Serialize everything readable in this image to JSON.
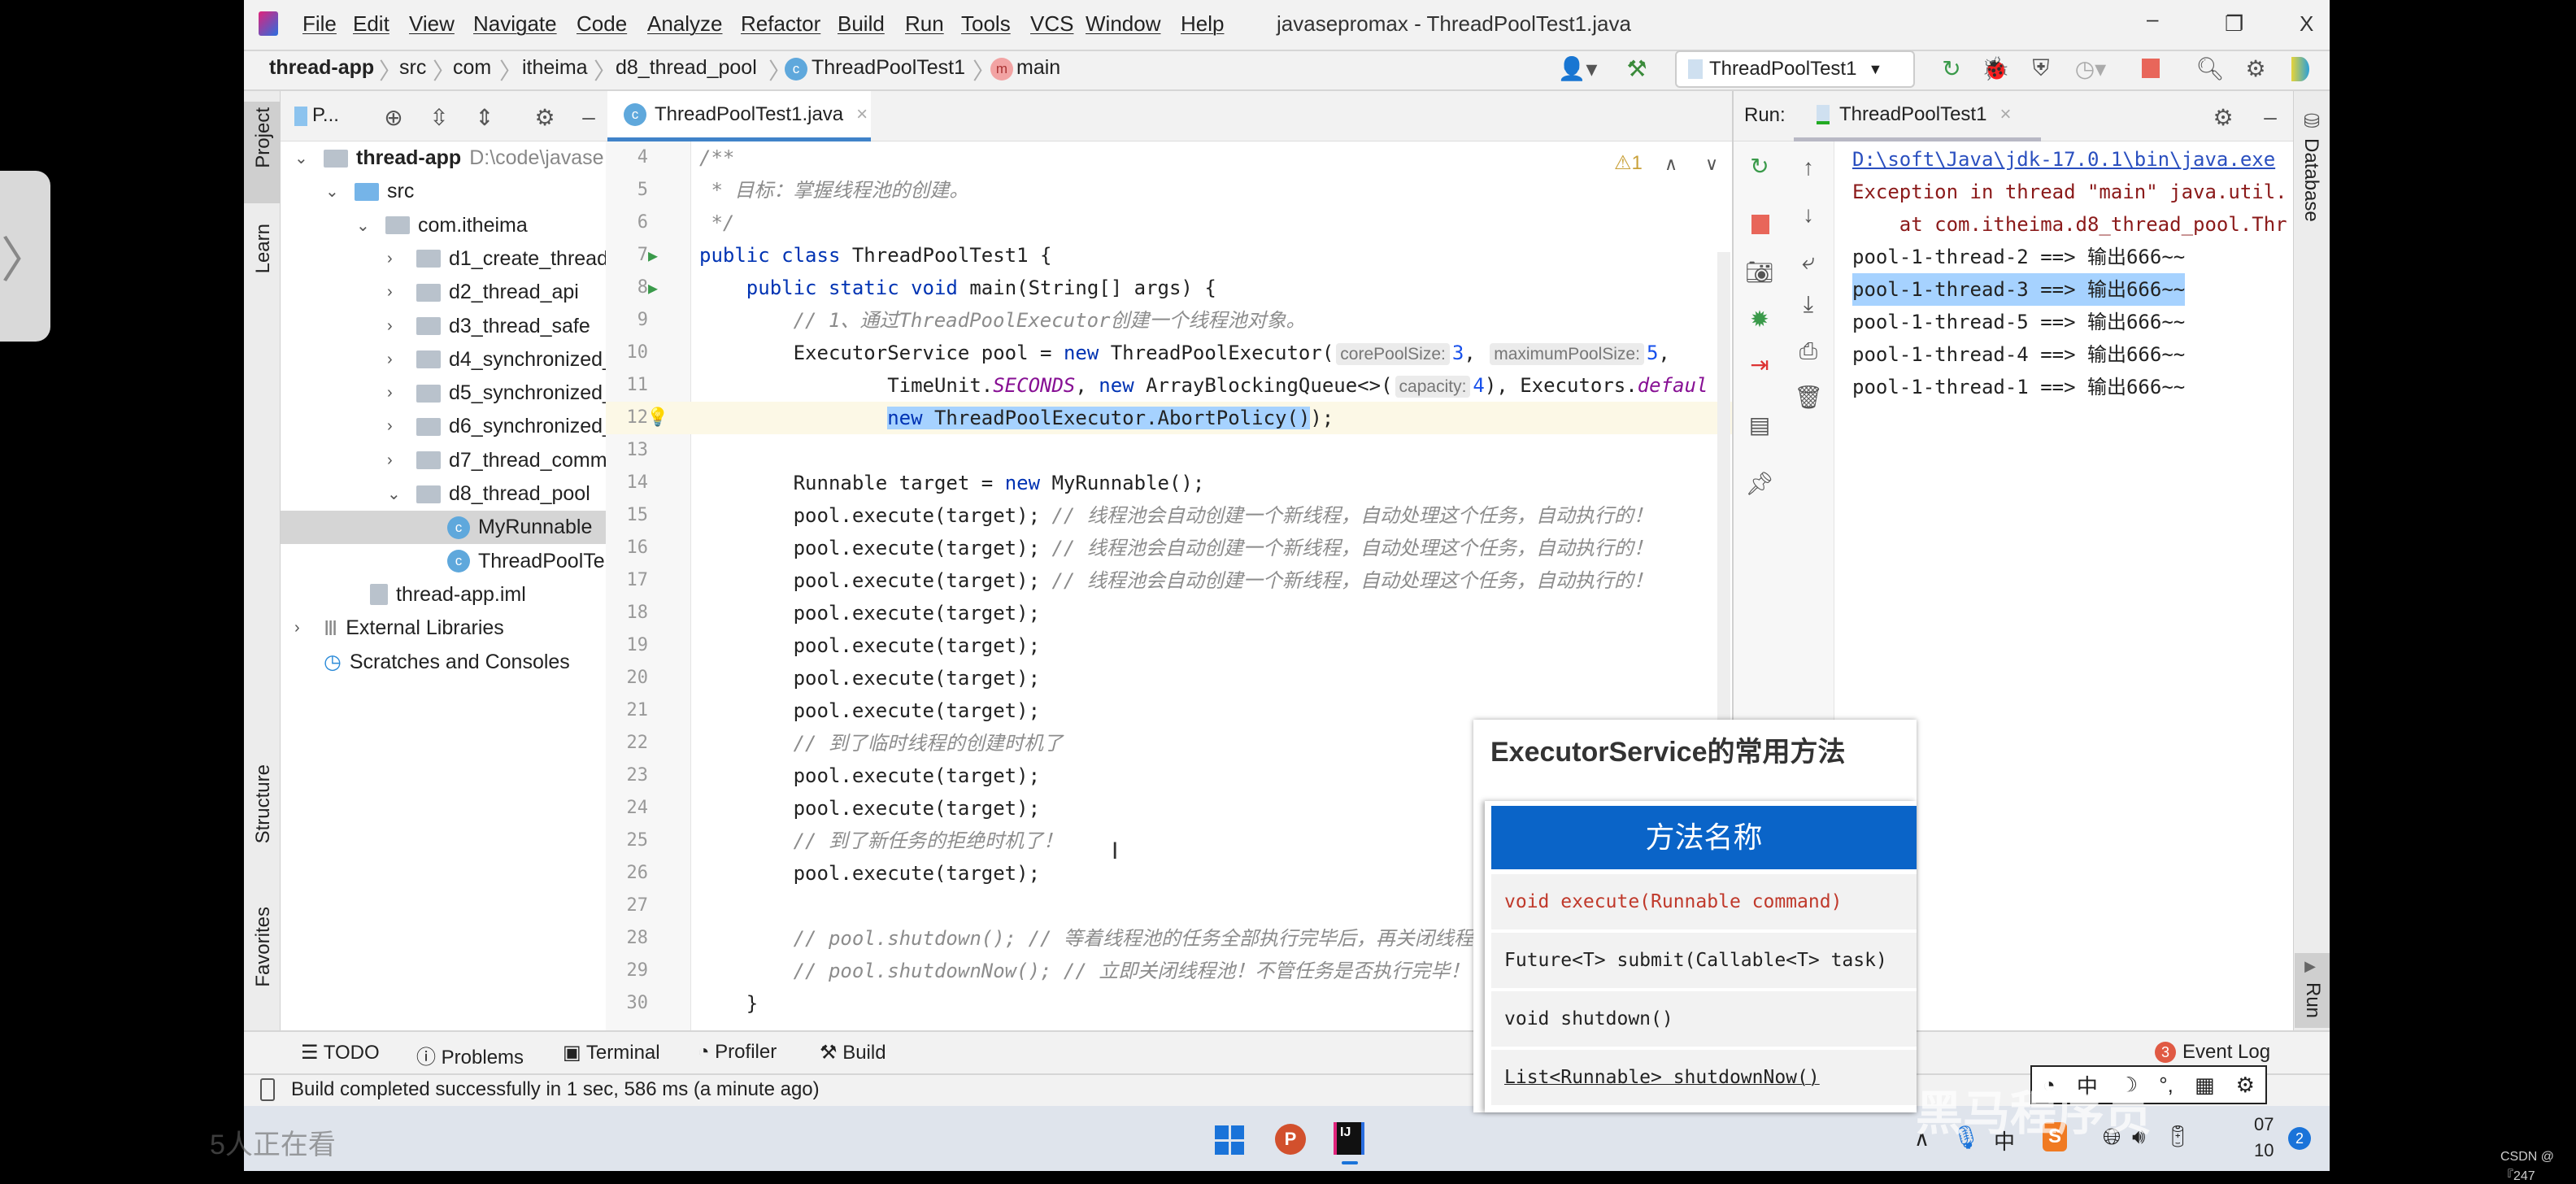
{
  "menu": {
    "items": [
      "File",
      "Edit",
      "View",
      "Navigate",
      "Code",
      "Analyze",
      "Refactor",
      "Build",
      "Run",
      "Tools",
      "VCS",
      "Window",
      "Help"
    ],
    "window_title": "javasepromax - ThreadPoolTest1.java",
    "minimize": "–",
    "restore": "❐",
    "close": "X"
  },
  "breadcrumb": [
    "thread-app",
    "src",
    "com",
    "itheima",
    "d8_thread_pool",
    "ThreadPoolTest1",
    "main"
  ],
  "toolbar": {
    "run_config": "ThreadPoolTest1"
  },
  "project": {
    "tab": "P...",
    "rows": [
      {
        "label": "thread-app",
        "extra": "D:\\code\\javase",
        "level": 0,
        "chev": "down",
        "icon": "module",
        "bold": true
      },
      {
        "label": "src",
        "level": 1,
        "chev": "down",
        "icon": "folder-blue"
      },
      {
        "label": "com.itheima",
        "level": 2,
        "chev": "down",
        "icon": "package"
      },
      {
        "label": "d1_create_thread",
        "level": 3,
        "chev": "right",
        "icon": "package"
      },
      {
        "label": "d2_thread_api",
        "level": 3,
        "chev": "right",
        "icon": "package"
      },
      {
        "label": "d3_thread_safe",
        "level": 3,
        "chev": "right",
        "icon": "package"
      },
      {
        "label": "d4_synchronized_",
        "level": 3,
        "chev": "right",
        "icon": "package"
      },
      {
        "label": "d5_synchronized_",
        "level": 3,
        "chev": "right",
        "icon": "package"
      },
      {
        "label": "d6_synchronized_",
        "level": 3,
        "chev": "right",
        "icon": "package"
      },
      {
        "label": "d7_thread_comm",
        "level": 3,
        "chev": "right",
        "icon": "package"
      },
      {
        "label": "d8_thread_pool",
        "level": 3,
        "chev": "down",
        "icon": "package"
      },
      {
        "label": "MyRunnable",
        "level": 4,
        "icon": "class",
        "selected": true
      },
      {
        "label": "ThreadPoolTe",
        "level": 4,
        "icon": "class-run"
      },
      {
        "label": "thread-app.iml",
        "level": 1.5,
        "icon": "file"
      },
      {
        "label": "External Libraries",
        "level": 0,
        "chev": "right",
        "icon": "library"
      },
      {
        "label": "Scratches and Consoles",
        "level": 0,
        "icon": "scratch"
      }
    ]
  },
  "left_stripe": {
    "project": "Project",
    "learn": "Learn",
    "structure": "Structure",
    "favorites": "Favorites"
  },
  "editor": {
    "tab": "ThreadPoolTest1.java",
    "warnings": "1",
    "lines": [
      {
        "n": "4",
        "seg": [
          [
            "/**",
            "cm"
          ]
        ]
      },
      {
        "n": "5",
        "seg": [
          [
            " * 目标：掌握线程池的创建。",
            "cm"
          ]
        ]
      },
      {
        "n": "6",
        "seg": [
          [
            " */",
            "cm"
          ]
        ]
      },
      {
        "n": "7",
        "run": true,
        "seg": [
          [
            "public class ",
            "kw"
          ],
          [
            "ThreadPoolTest1 {",
            ""
          ]
        ]
      },
      {
        "n": "8",
        "run": true,
        "seg": [
          [
            "    ",
            ""
          ],
          [
            "public static void ",
            "kw"
          ],
          [
            "main(String[] args) {",
            ""
          ]
        ]
      },
      {
        "n": "9",
        "seg": [
          [
            "        // 1、通过ThreadPoolExecutor创建一个线程池对象。",
            "cm"
          ]
        ]
      },
      {
        "n": "10",
        "seg": [
          [
            "        ExecutorService pool = ",
            ""
          ],
          [
            "new ",
            "kw"
          ],
          [
            "ThreadPoolExecutor(",
            ""
          ],
          [
            "corePoolSize:",
            "hint"
          ],
          [
            "3",
            "num"
          ],
          [
            ", ",
            ""
          ],
          [
            "maximumPoolSize:",
            "hint"
          ],
          [
            "5",
            "num"
          ],
          [
            ",",
            ""
          ]
        ]
      },
      {
        "n": "11",
        "seg": [
          [
            "                TimeUnit.",
            ""
          ],
          [
            "SECONDS",
            "st"
          ],
          [
            ", ",
            ""
          ],
          [
            "new ",
            "kw"
          ],
          [
            "ArrayBlockingQueue<>(",
            ""
          ],
          [
            "capacity:",
            "hint"
          ],
          [
            "4",
            "num"
          ],
          [
            "), Executors.",
            ""
          ],
          [
            "defaul",
            "st"
          ]
        ]
      },
      {
        "n": "12",
        "current": true,
        "bulb": true,
        "seg": [
          [
            "                ",
            ""
          ],
          [
            "new ",
            "kw sel"
          ],
          [
            "ThreadPoolExecutor.AbortPolicy()",
            "sel"
          ],
          [
            ");",
            ""
          ]
        ]
      },
      {
        "n": "13",
        "seg": []
      },
      {
        "n": "14",
        "seg": [
          [
            "        Runnable target = ",
            ""
          ],
          [
            "new ",
            "kw"
          ],
          [
            "MyRunnable();",
            ""
          ]
        ]
      },
      {
        "n": "15",
        "seg": [
          [
            "        pool.execute(target); ",
            ""
          ],
          [
            "// 线程池会自动创建一个新线程，自动处理这个任务，自动执行的！",
            "cm"
          ]
        ]
      },
      {
        "n": "16",
        "seg": [
          [
            "        pool.execute(target); ",
            ""
          ],
          [
            "// 线程池会自动创建一个新线程，自动处理这个任务，自动执行的！",
            "cm"
          ]
        ]
      },
      {
        "n": "17",
        "seg": [
          [
            "        pool.execute(target); ",
            ""
          ],
          [
            "// 线程池会自动创建一个新线程，自动处理这个任务，自动执行的！",
            "cm"
          ]
        ]
      },
      {
        "n": "18",
        "seg": [
          [
            "        pool.execute(target);",
            ""
          ]
        ]
      },
      {
        "n": "19",
        "seg": [
          [
            "        pool.execute(target);",
            ""
          ]
        ]
      },
      {
        "n": "20",
        "seg": [
          [
            "        pool.execute(target);",
            ""
          ]
        ]
      },
      {
        "n": "21",
        "seg": [
          [
            "        pool.execute(target);",
            ""
          ]
        ]
      },
      {
        "n": "22",
        "seg": [
          [
            "        // 到了临时线程的创建时机了",
            "cm"
          ]
        ]
      },
      {
        "n": "23",
        "seg": [
          [
            "        pool.execute(target);",
            ""
          ]
        ]
      },
      {
        "n": "24",
        "seg": [
          [
            "        pool.execute(target);",
            ""
          ]
        ]
      },
      {
        "n": "25",
        "seg": [
          [
            "        // 到了新任务的拒绝时机了！",
            "cm"
          ]
        ]
      },
      {
        "n": "26",
        "seg": [
          [
            "        pool.execute(target);",
            ""
          ]
        ]
      },
      {
        "n": "27",
        "seg": []
      },
      {
        "n": "28",
        "seg": [
          [
            "        // pool.shutdown(); // 等着线程池的任务全部执行完毕后，再关闭线程",
            "cm"
          ]
        ]
      },
      {
        "n": "29",
        "seg": [
          [
            "        // pool.shutdownNow(); // 立即关闭线程池！不管任务是否执行完毕！",
            "cm"
          ]
        ]
      },
      {
        "n": "30",
        "seg": [
          [
            "    }",
            ""
          ]
        ]
      }
    ]
  },
  "run": {
    "label": "Run:",
    "tab": "ThreadPoolTest1",
    "console": [
      {
        "text": "D:\\soft\\Java\\jdk-17.0.1\\bin\\java.exe",
        "kind": "link"
      },
      {
        "text": "Exception in thread \"main\" java.util.",
        "kind": "err"
      },
      {
        "text": "    at com.itheima.d8_thread_pool.Thr",
        "kind": "err"
      },
      {
        "text": "pool-1-thread-2 ==> 输出666~~",
        "kind": ""
      },
      {
        "text": "pool-1-thread-3 ==> 输出666~~",
        "kind": "hl"
      },
      {
        "text": "pool-1-thread-5 ==> 输出666~~",
        "kind": ""
      },
      {
        "text": "pool-1-thread-4 ==> 输出666~~",
        "kind": ""
      },
      {
        "text": "pool-1-thread-1 ==> 输出666~~",
        "kind": ""
      }
    ]
  },
  "right_stripe": {
    "database": "Database",
    "run": "Run"
  },
  "bottom_tabs": [
    "TODO",
    "Problems",
    "Terminal",
    "Profiler",
    "Build"
  ],
  "event_log": {
    "label": "Event Log",
    "count": "3"
  },
  "status": "Build completed successfully in 1 sec, 586 ms (a minute ago)",
  "overlay": {
    "title": "ExecutorService的常用方法",
    "header": "方法名称",
    "methods": [
      "void execute(Runnable command)",
      "Future<T> submit(Callable<T> task)",
      "void shutdown()",
      "List<Runnable> shutdownNow()"
    ],
    "highlight_color": "#c0392b",
    "header_color": "#0a64c8"
  },
  "watermark": "黑马程序员",
  "viewers": "5人正在看",
  "taskbar": {
    "clock_top": "07",
    "clock_bottom": "10",
    "notif": "2",
    "ime": "中"
  },
  "credit": "CSDN @『247"
}
